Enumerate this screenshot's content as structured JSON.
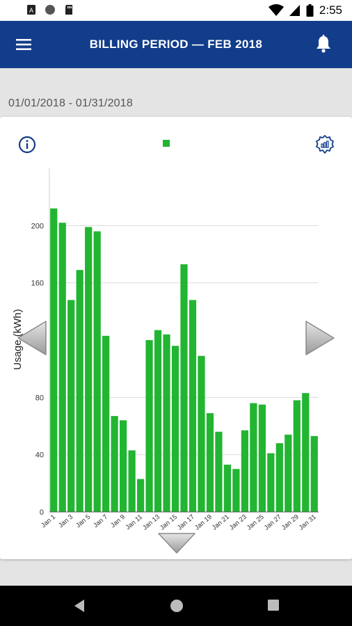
{
  "status_bar": {
    "time": "2:55",
    "icons": [
      "notification-a-icon",
      "circle-icon",
      "sd-card-icon",
      "wifi-icon",
      "signal-icon",
      "battery-icon"
    ]
  },
  "app_bar": {
    "title": "BILLING PERIOD  —  FEB 2018",
    "menu_icon": "hamburger-menu-icon",
    "bell_icon": "bell-icon",
    "background": "#123d8a"
  },
  "date_range": "01/01/2018 - 01/31/2018",
  "card": {
    "info_icon": "info-icon",
    "settings_icon": "chart-settings-icon",
    "legend_color": "#22b532"
  },
  "chart_data": {
    "type": "bar",
    "ylabel": "Usage (kWh)",
    "xlabel": "",
    "ylim": [
      0,
      240
    ],
    "yticks": [
      0,
      40,
      80,
      160,
      200
    ],
    "grid": true,
    "color": "#22b532",
    "categories": [
      "Jan 1",
      "Jan 2",
      "Jan 3",
      "Jan 4",
      "Jan 5",
      "Jan 6",
      "Jan 7",
      "Jan 8",
      "Jan 9",
      "Jan 10",
      "Jan 11",
      "Jan 12",
      "Jan 13",
      "Jan 14",
      "Jan 15",
      "Jan 16",
      "Jan 17",
      "Jan 18",
      "Jan 19",
      "Jan 20",
      "Jan 21",
      "Jan 22",
      "Jan 23",
      "Jan 24",
      "Jan 25",
      "Jan 26",
      "Jan 27",
      "Jan 28",
      "Jan 29",
      "Jan 30",
      "Jan 31"
    ],
    "tick_labels": [
      "Jan 1",
      "Jan 3",
      "Jan 5",
      "Jan 7",
      "Jan 9",
      "Jan 11",
      "Jan 13",
      "Jan 15",
      "Jan 17",
      "Jan 19",
      "Jan 21",
      "Jan 23",
      "Jan 25",
      "Jan 27",
      "Jan 29",
      "Jan 31"
    ],
    "values": [
      212,
      202,
      148,
      169,
      199,
      196,
      123,
      67,
      64,
      43,
      23,
      120,
      127,
      124,
      116,
      173,
      148,
      109,
      69,
      56,
      33,
      30,
      57,
      76,
      75,
      41,
      48,
      54,
      78,
      83,
      53
    ]
  },
  "nav_arrows": {
    "left": "chevron-left-icon",
    "right": "chevron-right-icon",
    "down": "chevron-down-icon"
  },
  "system_nav": {
    "back": "back-icon",
    "home": "home-icon",
    "recent": "recent-apps-icon"
  }
}
